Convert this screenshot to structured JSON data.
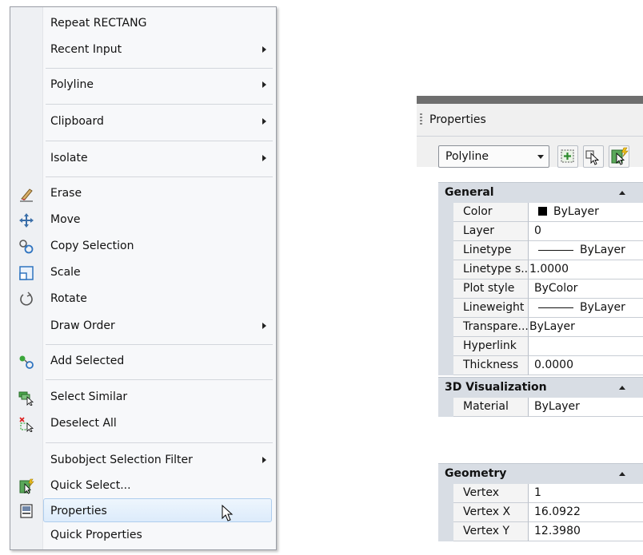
{
  "context_menu": {
    "items": [
      {
        "label": "Repeat RECTANG"
      },
      {
        "label": "Recent Input",
        "submenu": true
      },
      {
        "label": "Polyline",
        "submenu": true
      },
      {
        "label": "Clipboard",
        "submenu": true
      },
      {
        "label": "Isolate",
        "submenu": true
      },
      {
        "label": "Erase",
        "icon": "eraser-icon"
      },
      {
        "label": "Move",
        "icon": "move-icon"
      },
      {
        "label": "Copy Selection",
        "icon": "copy-selection-icon"
      },
      {
        "label": "Scale",
        "icon": "scale-icon"
      },
      {
        "label": "Rotate",
        "icon": "rotate-icon"
      },
      {
        "label": "Draw Order",
        "submenu": true
      },
      {
        "label": "Add Selected",
        "icon": "add-selected-icon"
      },
      {
        "label": "Select Similar",
        "icon": "select-similar-icon"
      },
      {
        "label": "Deselect All",
        "icon": "deselect-all-icon"
      },
      {
        "label": "Subobject Selection Filter",
        "submenu": true
      },
      {
        "label": "Quick Select...",
        "icon": "quick-select-icon"
      },
      {
        "label": "Properties",
        "icon": "properties-icon",
        "highlighted": true
      },
      {
        "label": "Quick Properties"
      }
    ]
  },
  "properties_palette": {
    "title": "Properties",
    "object_type": "Polyline",
    "sections": [
      {
        "title": "General",
        "rows": [
          {
            "name": "Color",
            "value": "ByLayer"
          },
          {
            "name": "Layer",
            "value": "0"
          },
          {
            "name": "Linetype",
            "value": "ByLayer"
          },
          {
            "name": "Linetype s...",
            "value": "1.0000"
          },
          {
            "name": "Plot style",
            "value": "ByColor"
          },
          {
            "name": "Lineweight",
            "value": "ByLayer"
          },
          {
            "name": "Transpare...",
            "value": "ByLayer"
          },
          {
            "name": "Hyperlink",
            "value": ""
          },
          {
            "name": "Thickness",
            "value": "0.0000"
          }
        ]
      },
      {
        "title": "3D Visualization",
        "rows": [
          {
            "name": "Material",
            "value": "ByLayer"
          }
        ]
      },
      {
        "title": "Geometry",
        "rows": [
          {
            "name": "Vertex",
            "value": "1"
          },
          {
            "name": "Vertex X",
            "value": "16.0922"
          },
          {
            "name": "Vertex Y",
            "value": "12.3980"
          }
        ]
      }
    ]
  },
  "colors": {
    "highlight": "#dcebfb",
    "section_header": "#d8dde4",
    "palette_topbar": "#6e6e6e"
  }
}
